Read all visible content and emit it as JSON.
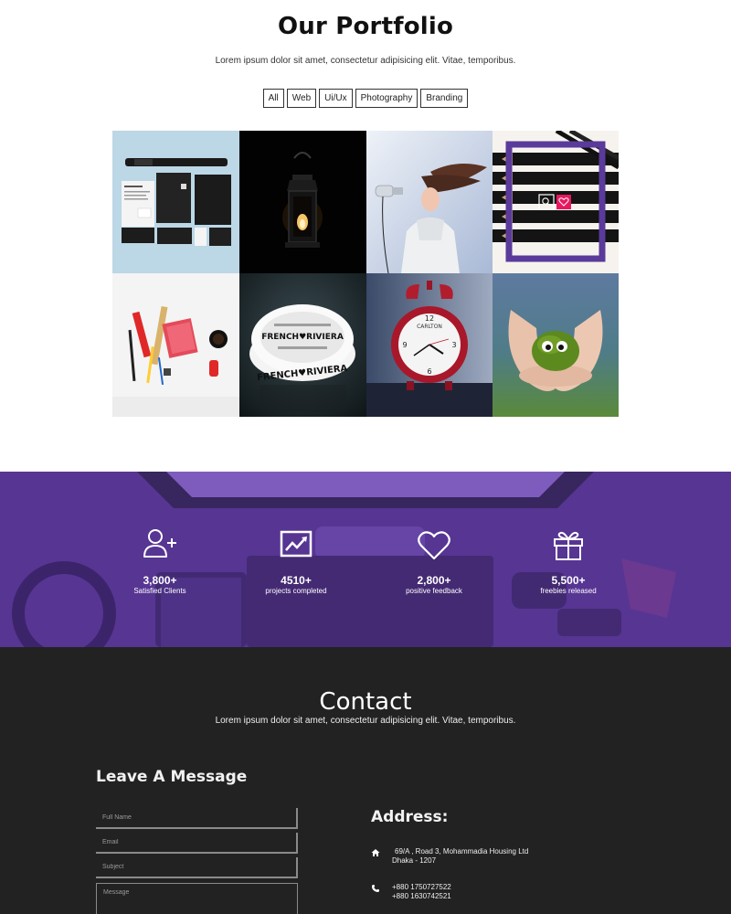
{
  "portfolio": {
    "title": "Our Portfolio",
    "subtitle": "Lorem ipsum dolor sit amet, consectetur adipisicing elit. Vitae, temporibus.",
    "filters": [
      "All",
      "Web",
      "Ui/Ux",
      "Photography",
      "Branding"
    ],
    "tiles": [
      {
        "icon": "stationery-mockup"
      },
      {
        "icon": "lantern-photo"
      },
      {
        "icon": "hair-dryer-photo"
      },
      {
        "icon": "pencils-photo",
        "hovered": true,
        "overlay_icons": [
          "search-icon",
          "heart-icon"
        ]
      },
      {
        "icon": "desk-tools-photo"
      },
      {
        "icon": "ashtray-photo",
        "ashtray_text": "FRENCH RIVIERA"
      },
      {
        "icon": "alarm-clock-photo",
        "clock_brand": "CARLTON"
      },
      {
        "icon": "moss-creature-photo"
      }
    ]
  },
  "stats": {
    "items": [
      {
        "icon": "user-plus-icon",
        "number": "3,800+",
        "label": "Satisfied Clients"
      },
      {
        "icon": "chart-icon",
        "number": "4510+",
        "label": "projects completed"
      },
      {
        "icon": "heart-icon",
        "number": "2,800+",
        "label": "positive feedback"
      },
      {
        "icon": "gift-icon",
        "number": "5,500+",
        "label": "freebies released"
      }
    ]
  },
  "contact": {
    "title": "Contact",
    "subtitle": "Lorem ipsum dolor sit amet, consectetur adipisicing elit. Vitae, temporibus.",
    "form": {
      "heading": "Leave A Message",
      "full_name_placeholder": "Full Name",
      "email_placeholder": "Email",
      "subject_placeholder": "Subject",
      "message_placeholder": "Message"
    },
    "address": {
      "heading": "Address:",
      "home_icon": "home-icon",
      "line1": "69/A , Road 3, Mohammadia Housing Ltd",
      "line2": "Dhaka - 1207",
      "phone_icon": "phone-icon",
      "phone1": "+880 1750727522",
      "phone2": "+880 1630742521"
    }
  },
  "colors": {
    "accent_purple": "#5b3a9c",
    "accent_pink": "#e8185f",
    "dark_bg": "#222222"
  }
}
